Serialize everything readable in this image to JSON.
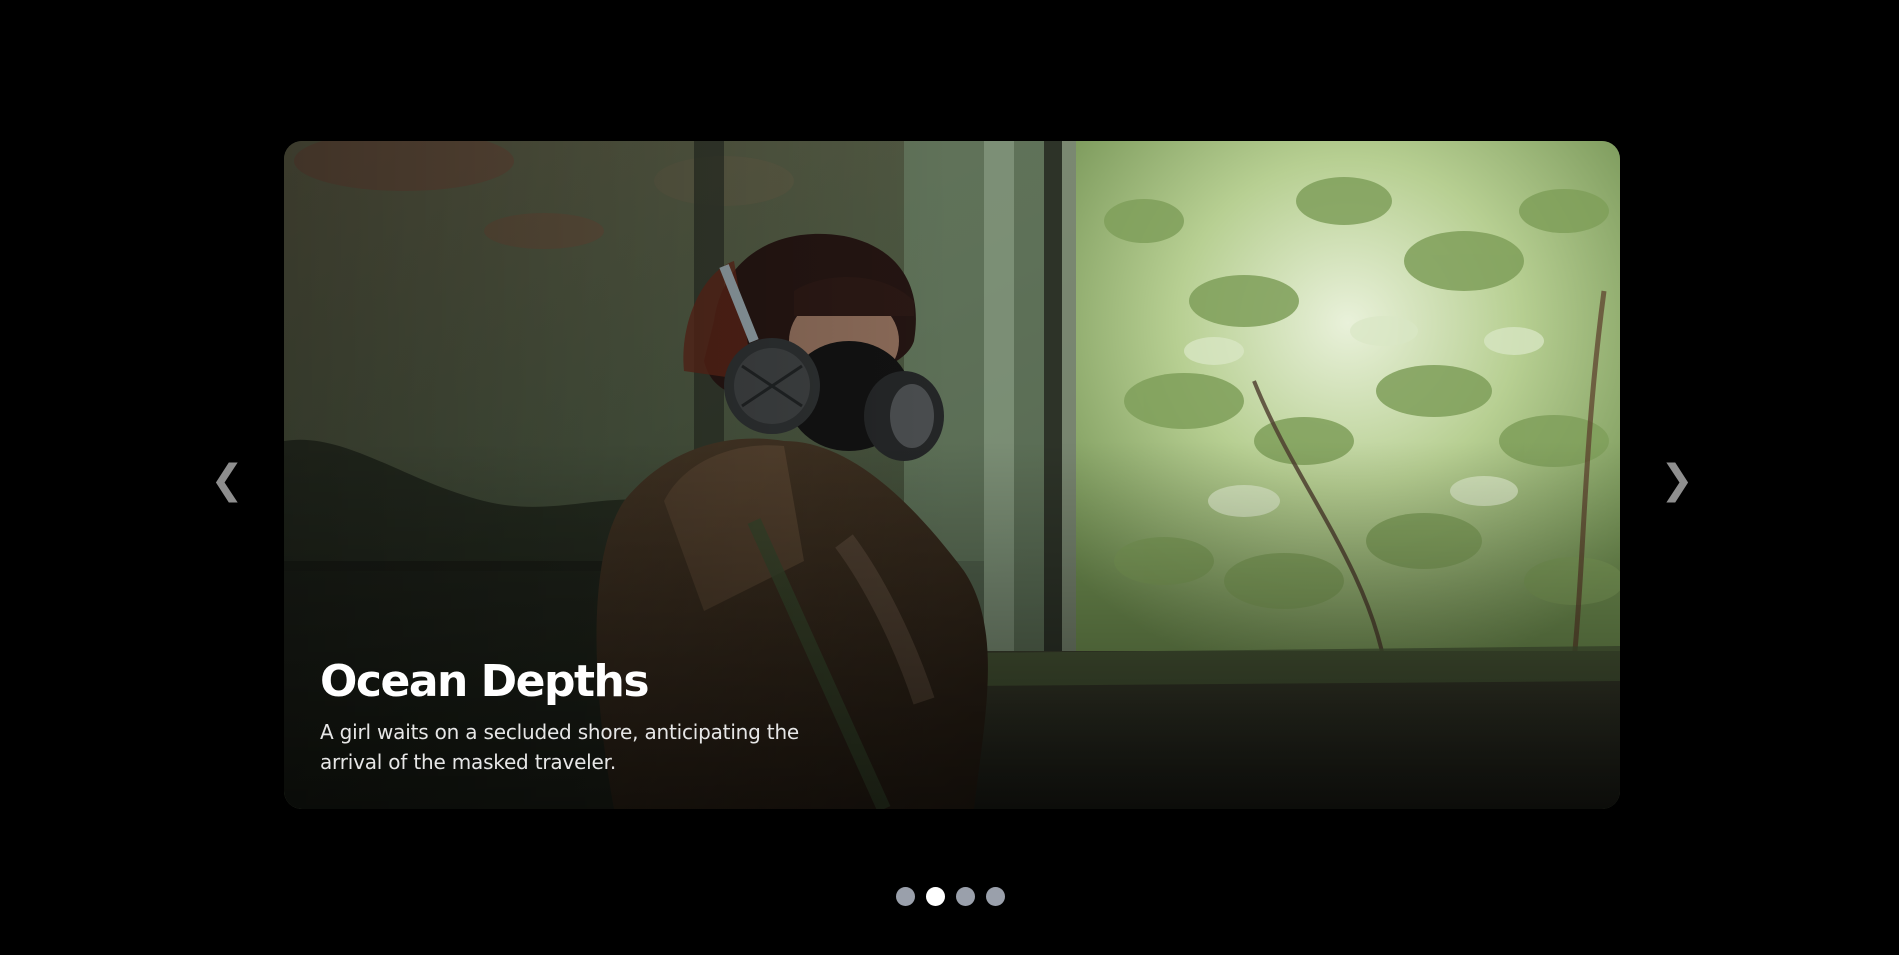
{
  "carousel": {
    "slide": {
      "title": "Ocean Depths",
      "description": "A girl waits on a secluded shore, anticipating the arrival of the masked traveler.",
      "image_subject": "person in gas mask and hooded jacket beside overgrown window"
    },
    "prev_icon": "chevron-left-icon",
    "next_icon": "chevron-right-icon",
    "prev_glyph": "❮",
    "next_glyph": "❯",
    "dots": [
      {
        "active": false
      },
      {
        "active": true
      },
      {
        "active": false
      },
      {
        "active": false
      }
    ],
    "active_index": 1
  },
  "colors": {
    "background": "#000000",
    "dot_inactive": "#9aa0ab",
    "dot_active": "#ffffff",
    "arrow": "#8e8e8e"
  }
}
